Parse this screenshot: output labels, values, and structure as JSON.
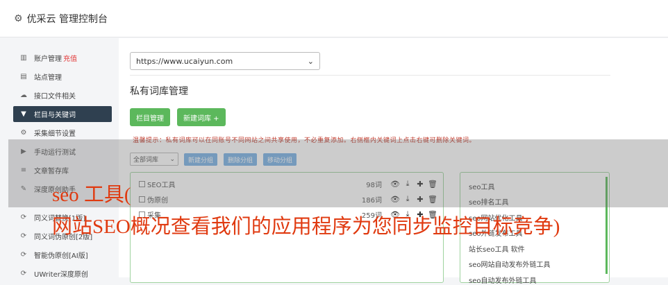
{
  "header": {
    "title": "优采云 管理控制台"
  },
  "sidebar": {
    "items": [
      {
        "label": "账户管理",
        "highlight": "充值"
      },
      {
        "label": "站点管理"
      },
      {
        "label": "接口文件相关"
      },
      {
        "label": "栏目与关键词"
      },
      {
        "label": "采集细节设置"
      },
      {
        "label": "手动运行测试"
      },
      {
        "label": "文章暂存库"
      },
      {
        "label": "深度原创助手"
      },
      {
        "label": "同义词替换[1版]"
      },
      {
        "label": "同义词伪原创[2版]"
      },
      {
        "label": "智能伪原创[AI版]"
      },
      {
        "label": "UWriter深度原创"
      }
    ]
  },
  "main": {
    "url_value": "https://www.ucaiyun.com",
    "section_title": "私有词库管理",
    "btn_category": "栏目管理",
    "btn_new_lib": "新建词库 +",
    "tip": "温馨提示：私有词库可以在同账号不同网站之间共享使用，不必重复添加。右侧框内关键词上点击右键可删除关键词。",
    "filter_value": "全部词库",
    "btn_new_group": "新建分组",
    "btn_delete_group": "删除分组",
    "btn_move_group": "移动分组",
    "libraries": [
      {
        "name": "SEO工具",
        "count": "98词"
      },
      {
        "name": "伪原创",
        "count": "186词"
      },
      {
        "name": "采集",
        "count": "259词"
      }
    ],
    "keywords": [
      "seo工具",
      "seo排名工具",
      "seo网站优化工具",
      "seo外链发布工具",
      "站长seo工具 软件",
      "seo网站自动发布外链工具",
      "seo自动发布外链工具"
    ]
  },
  "overlay_text": {
    "line1": "seo 工具(",
    "line2": "网站SEO概况查看我们的应用程序为您同步监控目标竞争)"
  }
}
